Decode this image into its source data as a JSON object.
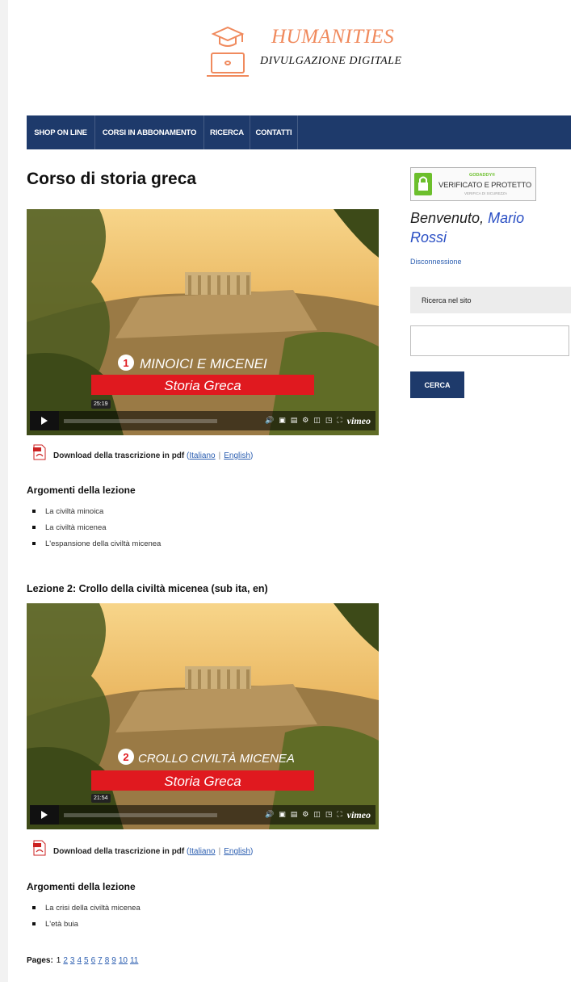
{
  "colors": {
    "accent_orange": "#f08a5d",
    "nav_blue": "#1e3a6b",
    "link_blue": "#2a5db0",
    "user_blue": "#2a4fc4",
    "red_banner": "#e0191f",
    "badge_green": "#6cbf2c"
  },
  "header": {
    "logo_icon": "graduation-laptop-icon",
    "title": "HUMANITIES",
    "subtitle": "DIVULGAZIONE DIGITALE"
  },
  "nav": {
    "items": [
      {
        "label": "SHOP ON LINE"
      },
      {
        "label": "CORSI IN ABBONAMENTO"
      },
      {
        "label": "RICERCA"
      },
      {
        "label": "CONTATTI"
      }
    ]
  },
  "main": {
    "page_title": "Corso di storia greca",
    "lessons": [
      {
        "title": "",
        "video": {
          "number": "1",
          "overlay_title": "MINOICI E MICENEI",
          "overlay_subtitle": "Storia Greca",
          "time": "25:19",
          "player": "vimeo"
        },
        "pdf": {
          "icon": "pdf-icon",
          "label": "Download della trascrizione in pdf",
          "open_paren": "(",
          "link_it": "Italiano",
          "separator": "|",
          "link_en": "English",
          "close_paren": ")"
        },
        "topics_heading": "Argomenti della lezione",
        "topics": [
          "La civiltà minoica",
          "La civiltà micenea",
          "L'espansione della civiltà micenea"
        ]
      },
      {
        "title": "Lezione 2: Crollo della civiltà micenea (sub ita, en)",
        "video": {
          "number": "2",
          "overlay_title": "CROLLO CIVILTÀ MICENEA",
          "overlay_subtitle": "Storia Greca",
          "time": "21:54",
          "player": "vimeo"
        },
        "pdf": {
          "icon": "pdf-icon",
          "label": "Download della trascrizione in pdf",
          "open_paren": "(",
          "link_it": "Italiano",
          "separator": "|",
          "link_en": "English",
          "close_paren": ")"
        },
        "topics_heading": "Argomenti della lezione",
        "topics": [
          "La crisi della civiltà micenea",
          "L'età buia"
        ]
      }
    ],
    "pagination": {
      "label": "Pages:",
      "current": "1",
      "pages": [
        "2",
        "3",
        "4",
        "5",
        "6",
        "7",
        "8",
        "9",
        "10",
        "11"
      ]
    }
  },
  "sidebar": {
    "badge": {
      "icon": "lock-icon",
      "brand": "GODADDY®",
      "main": "VERIFICATO E PROTETTO",
      "sub": "VERIFICA DI SICUREZZA"
    },
    "welcome_text": "Benvenuto,",
    "user_name": "Mario Rossi",
    "logout_label": "Disconnessione",
    "search_heading": "Ricerca nel sito",
    "search_value": "",
    "search_button": "CERCA"
  }
}
